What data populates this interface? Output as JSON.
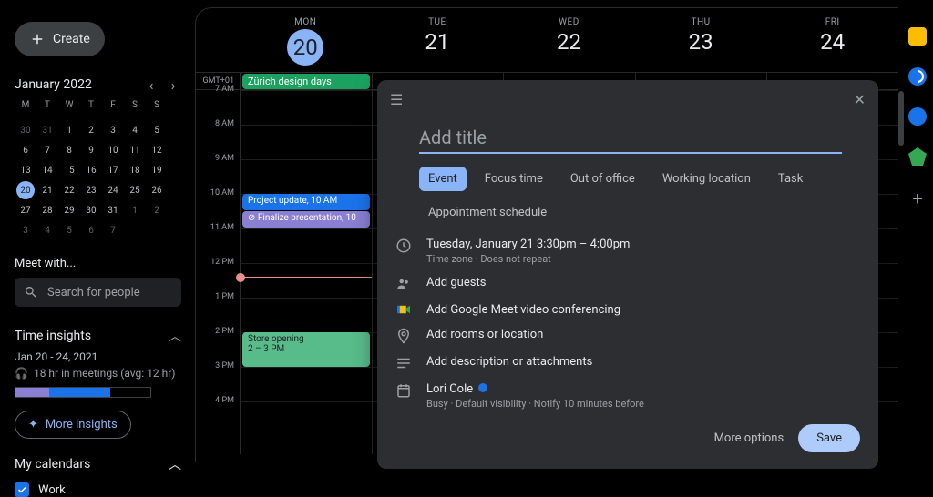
{
  "create_label": "Create",
  "mini_calendar": {
    "title": "January 2022",
    "dow": [
      "M",
      "T",
      "W",
      "T",
      "F",
      "S",
      "S"
    ],
    "weeks": [
      [
        {
          "d": "30",
          "dim": true
        },
        {
          "d": "31",
          "dim": true
        },
        {
          "d": "1"
        },
        {
          "d": "2"
        },
        {
          "d": "3"
        },
        {
          "d": "4"
        },
        {
          "d": "5"
        }
      ],
      [
        {
          "d": "6"
        },
        {
          "d": "7"
        },
        {
          "d": "8"
        },
        {
          "d": "9"
        },
        {
          "d": "10"
        },
        {
          "d": "11"
        },
        {
          "d": "12"
        }
      ],
      [
        {
          "d": "13"
        },
        {
          "d": "14"
        },
        {
          "d": "15"
        },
        {
          "d": "16"
        },
        {
          "d": "17"
        },
        {
          "d": "18"
        },
        {
          "d": "19"
        }
      ],
      [
        {
          "d": "20",
          "today": true
        },
        {
          "d": "21"
        },
        {
          "d": "22"
        },
        {
          "d": "23"
        },
        {
          "d": "24"
        },
        {
          "d": "25"
        },
        {
          "d": "26"
        }
      ],
      [
        {
          "d": "27"
        },
        {
          "d": "28"
        },
        {
          "d": "29"
        },
        {
          "d": "30"
        },
        {
          "d": "31"
        },
        {
          "d": "1",
          "dim": true
        },
        {
          "d": "2",
          "dim": true
        }
      ],
      [
        {
          "d": "3",
          "dim": true
        },
        {
          "d": "4",
          "dim": true
        },
        {
          "d": "5",
          "dim": true
        },
        {
          "d": "6",
          "dim": true
        },
        {
          "d": "7",
          "dim": true
        },
        {
          "d": "",
          "dim": true
        },
        {
          "d": "",
          "dim": true
        }
      ]
    ]
  },
  "meet_with_label": "Meet with...",
  "search_placeholder": "Search for people",
  "time_insights": {
    "title": "Time insights",
    "range": "Jan 20 - 24, 2021",
    "subtitle": "18 hr in meetings (avg: 12 hr)",
    "button": "More insights"
  },
  "my_calendars": {
    "title": "My calendars",
    "items": [
      {
        "label": "Work",
        "checked": true
      }
    ]
  },
  "timezone": "GMT+01",
  "day_headers": [
    {
      "dow": "MON",
      "num": "20",
      "selected": true
    },
    {
      "dow": "TUE",
      "num": "21"
    },
    {
      "dow": "WED",
      "num": "22"
    },
    {
      "dow": "THU",
      "num": "23"
    },
    {
      "dow": "FRI",
      "num": "24"
    }
  ],
  "allday_event": "Zürich design days",
  "hours": [
    "7 AM",
    "8 AM",
    "9 AM",
    "10 AM",
    "11 AM",
    "12 PM",
    "1 PM",
    "2 PM",
    "3 PM",
    "4 PM"
  ],
  "events": {
    "project_update": "Project update, 10 AM",
    "finalize": "Finalize presentation, 10",
    "store_opening_title": "Store opening",
    "store_opening_time": "2 – 3 PM"
  },
  "modal": {
    "title_placeholder": "Add title",
    "tabs": [
      "Event",
      "Focus time",
      "Out of office",
      "Working location",
      "Task",
      "Appointment schedule"
    ],
    "datetime_line": "Tuesday, January 21    3:30pm   –   4:00pm",
    "datetime_sub": "Time zone · Does not repeat",
    "add_guests": "Add guests",
    "add_meet": "Add Google Meet video conferencing",
    "add_location": "Add rooms or location",
    "add_description": "Add description or attachments",
    "organizer": "Lori Cole",
    "organizer_sub": "Busy · Default visibility · Notify 10 minutes before",
    "more_options": "More options",
    "save": "Save"
  }
}
